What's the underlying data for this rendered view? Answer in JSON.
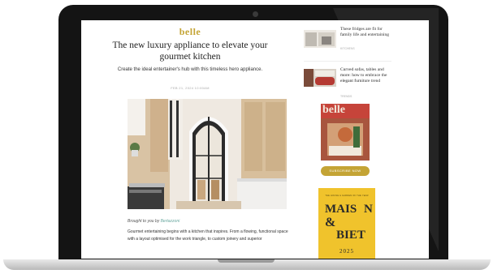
{
  "article": {
    "brand": "belle",
    "title": "The new luxury appliance to elevate your gourmet kitchen",
    "subtitle": "Create the ideal entertainer's hub with this timeless hero appliance.",
    "date": "FEB 21, 2024 10:00AM",
    "byline_prefix": "Brought to you by",
    "byline_link": "Bertazzoni",
    "body": "Gourmet entertaining begins with a kitchen that inspires. From a flowing, functional space with a layout optimised for the work triangle, to custom joinery and superior"
  },
  "sidebar": {
    "items": [
      {
        "title": "These fridges are fit for family life and entertaining",
        "meta": "KITCHENS"
      },
      {
        "title": "Curved sofas, tables and more: how to embrace the elegant furniture trend",
        "meta": "TRENDS"
      }
    ],
    "magazine_name": "belle",
    "subscribe_label": "SUBSCRIBE NOW",
    "ad": {
      "top_text": "THE HOUSE & GARDEN OF THE YEAR",
      "word1": "MAIS",
      "word2": "N",
      "amp": "&",
      "word3": "BIET",
      "year": "2025"
    }
  },
  "colors": {
    "accent": "#c4a435",
    "link": "#6aa8a0",
    "magazine_red": "#c6443a",
    "ad_yellow": "#f0c32c"
  }
}
